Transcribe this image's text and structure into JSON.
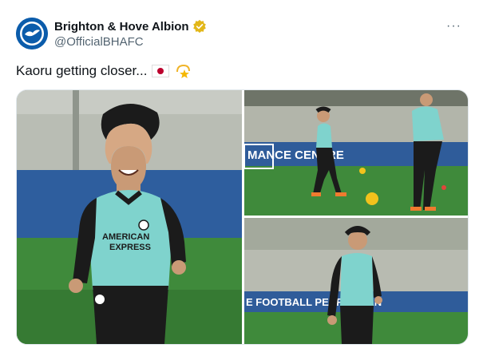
{
  "account": {
    "display_name": "Brighton & Hove Albion",
    "handle": "@OfficialBHAFC",
    "avatar_icon": "brighton-crest-icon",
    "verified_icon": "verified-badge-icon",
    "verified_color": "#e2b719"
  },
  "more_icon": "more-options-icon",
  "more_label": "···",
  "tweet": {
    "text": "Kaoru getting closer...",
    "emoji_1": "japan-flag-icon",
    "emoji_2": "dizzy-star-icon"
  },
  "media": {
    "photo_1": {
      "alt": "Kaoru Mitoma smiling while jogging in training",
      "shirt_text_1": "AMERICAN",
      "shirt_text_2": "EXPRESS"
    },
    "photo_2": {
      "alt": "Players training with footballs",
      "board_text": "MANCE CENTRE"
    },
    "photo_3": {
      "alt": "Kaoru Mitoma running on the training pitch",
      "board_text": "E FOOTBALL PERFORMAN"
    }
  },
  "colors": {
    "brand_blue": "#0b5cab",
    "shirt_turquoise": "#7fd3cd",
    "pitch_green": "#3f8a3b"
  }
}
